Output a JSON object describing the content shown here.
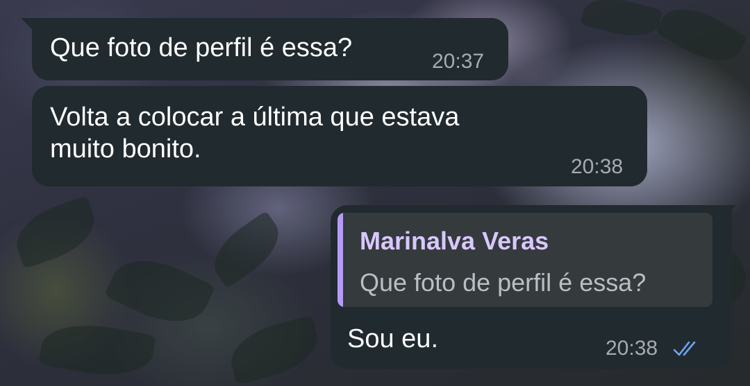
{
  "messages": [
    {
      "direction": "incoming",
      "text": "Que foto de perfil é essa?",
      "time": "20:37"
    },
    {
      "direction": "incoming",
      "text": "Volta a colocar a última que estava\nmuito bonito.",
      "time": "20:38"
    },
    {
      "direction": "outgoing",
      "reply_to": {
        "name": "Marinalva Veras",
        "text": "Que foto de perfil é essa?"
      },
      "text": "Sou eu.",
      "time": "20:38",
      "status_icon": "double-check-read-icon"
    }
  ],
  "colors": {
    "bubble": "#212a2e",
    "time": "#a6acb0",
    "reply_accent": "#b49cf6",
    "reply_name": "#d8c8ff",
    "read_ticks": "#6fa3f7"
  }
}
